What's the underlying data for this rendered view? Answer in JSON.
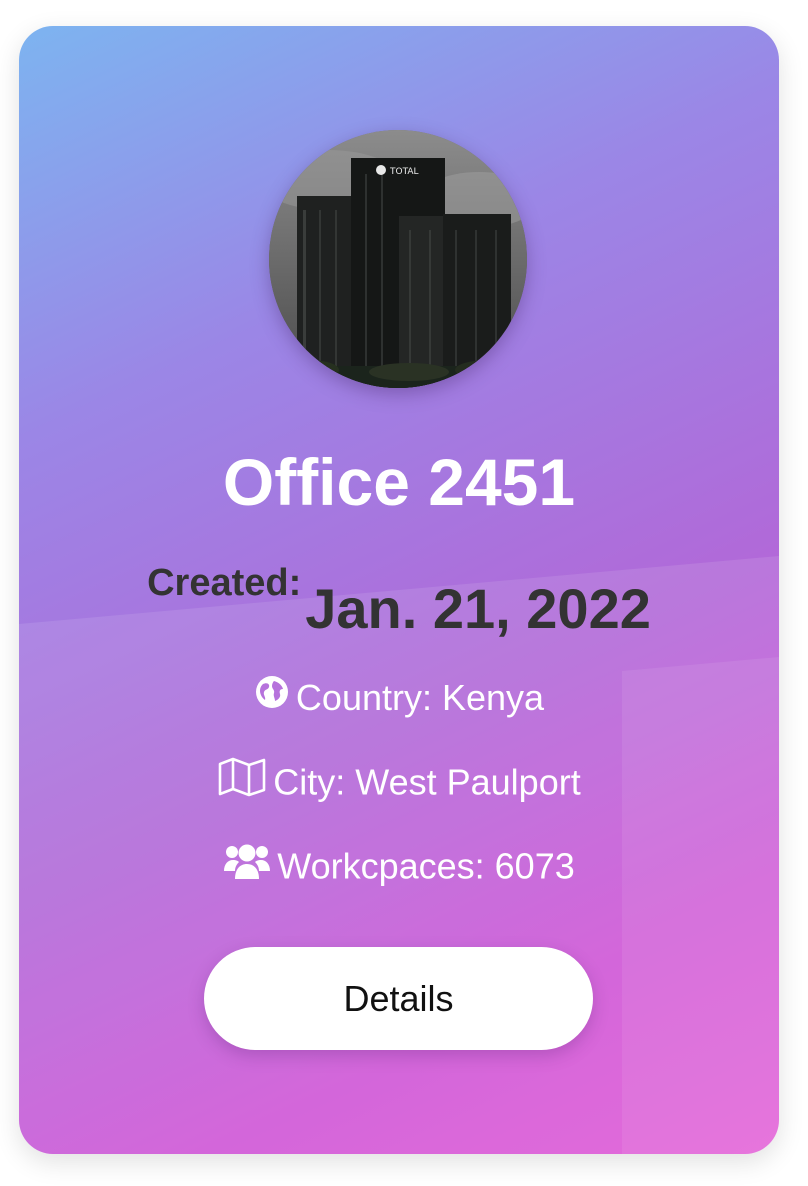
{
  "card": {
    "title": "Office 2451",
    "created_label": "Created:",
    "created_date": "Jan. 21, 2022",
    "country": "Country: Kenya",
    "city": "City: West Paulport",
    "workspaces": "Workcpaces: 6073",
    "details_label": "Details",
    "photo_sign": "TOTAL"
  },
  "icons": {
    "country": "globe-icon",
    "city": "map-icon",
    "workspaces": "users-icon"
  },
  "colors": {
    "gradient_start": "#7db4f0",
    "gradient_mid": "#b06ad9",
    "gradient_end": "#e25ad6",
    "button_bg": "#ffffff",
    "date_text": "#333333"
  }
}
